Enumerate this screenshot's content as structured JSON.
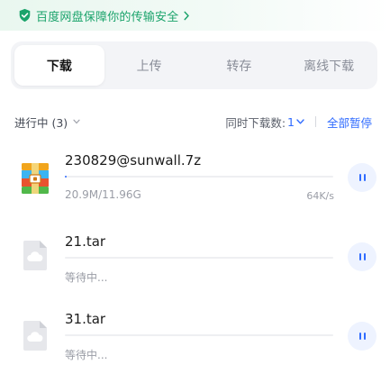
{
  "banner": {
    "text": "百度网盘保障你的传输安全",
    "icon": "shield-check-icon",
    "color": "#1aa36b"
  },
  "tabs": [
    {
      "label": "下载",
      "active": true
    },
    {
      "label": "上传",
      "active": false
    },
    {
      "label": "转存",
      "active": false
    },
    {
      "label": "离线下载",
      "active": false
    }
  ],
  "subbar": {
    "filter_label": "进行中 (3)",
    "concurrent_label": "同时下载数:",
    "concurrent_value": "1",
    "pause_all": "全部暂停"
  },
  "downloads": [
    {
      "name": "230829@sunwall.7z",
      "progress_text": "20.9M/11.96G",
      "speed": "64K/s",
      "progress": 0.0017,
      "icon": "archive-icon"
    },
    {
      "name": "21.tar",
      "status": "等待中...",
      "progress": 0,
      "icon": "cloud-file-icon"
    },
    {
      "name": "31.tar",
      "status": "等待中...",
      "progress": 0,
      "icon": "cloud-file-icon"
    }
  ],
  "colors": {
    "accent": "#2f6bff",
    "secure_green": "#1aa36b",
    "tab_bg": "#f3f4f7"
  }
}
